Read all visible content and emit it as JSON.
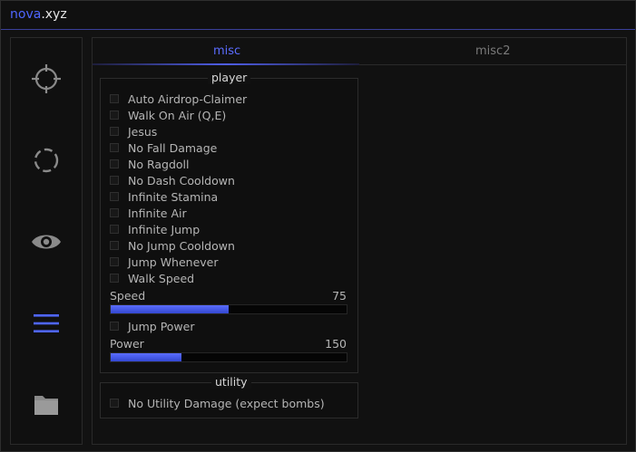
{
  "titlebar": {
    "brand": "nova",
    "suffix": ".xyz"
  },
  "sidebar": {
    "items": [
      {
        "icon": "crosshair-icon"
      },
      {
        "icon": "refresh-icon"
      },
      {
        "icon": "eye-icon"
      },
      {
        "icon": "menu-icon",
        "active": true
      },
      {
        "icon": "folder-icon"
      }
    ]
  },
  "tabs": [
    {
      "label": "misc",
      "active": true
    },
    {
      "label": "misc2",
      "active": false
    }
  ],
  "player": {
    "title": "player",
    "options": [
      "Auto Airdrop-Claimer",
      "Walk On Air (Q,E)",
      "Jesus",
      "No Fall Damage",
      "No Ragdoll",
      "No Dash Cooldown",
      "Infinite Stamina",
      "Infinite Air",
      "Infinite Jump",
      "No Jump Cooldown",
      "Jump Whenever",
      "Walk Speed"
    ],
    "speed": {
      "label": "Speed",
      "value": "75",
      "fill_fraction": 0.5
    },
    "jump_power": "Jump Power",
    "power": {
      "label": "Power",
      "value": "150",
      "fill_fraction": 0.3
    }
  },
  "utility": {
    "title": "utility",
    "options": [
      "No Utility Damage (expect bombs)"
    ]
  },
  "colors": {
    "accent": "#4f66ff",
    "background": "#121212"
  }
}
